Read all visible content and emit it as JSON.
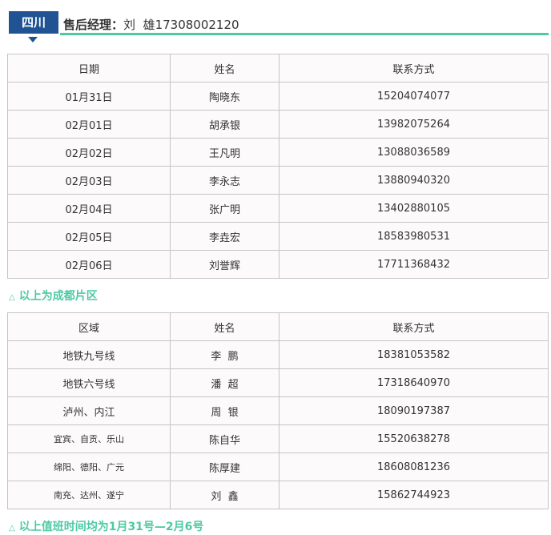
{
  "header": {
    "region": "四川",
    "label": "售后经理：",
    "manager": "刘  雄",
    "phone": "17308002120"
  },
  "table1": {
    "columns": [
      "日期",
      "姓名",
      "联系方式"
    ],
    "rows": [
      [
        "01月31日",
        "陶晓东",
        "15204074077"
      ],
      [
        "02月01日",
        "胡承银",
        "13982075264"
      ],
      [
        "02月02日",
        "王凡明",
        "13088036589"
      ],
      [
        "02月03日",
        "李永志",
        "13880940320"
      ],
      [
        "02月04日",
        "张广明",
        "13402880105"
      ],
      [
        "02月05日",
        "李垚宏",
        "18583980531"
      ],
      [
        "02月06日",
        "刘誉辉",
        "17711368432"
      ]
    ]
  },
  "note1": "以上为成都片区",
  "table2": {
    "columns": [
      "区域",
      "姓名",
      "联系方式"
    ],
    "rows": [
      [
        "地铁九号线",
        "李  鹏",
        "18381053582"
      ],
      [
        "地铁六号线",
        "潘  超",
        "17318640970"
      ],
      [
        "泸州、内江",
        "周  银",
        "18090197387"
      ],
      [
        "宜宾、自贡、乐山",
        "陈自华",
        "15520638278"
      ],
      [
        "绵阳、德阳、广元",
        "陈厚建",
        "18608081236"
      ],
      [
        "南充、达州、遂宁",
        "刘  鑫",
        "15862744923"
      ]
    ]
  },
  "note2": "以上值班时间均为1月31号—2月6号",
  "colors": {
    "tag_bg": "#1f5394",
    "accent": "#4ec9a3",
    "border": "#c8c4c5",
    "cell_bg": "#fcfafb"
  },
  "icons": {
    "note_marker": "triangle-up-outline-icon",
    "tag_pointer": "triangle-down-icon"
  }
}
